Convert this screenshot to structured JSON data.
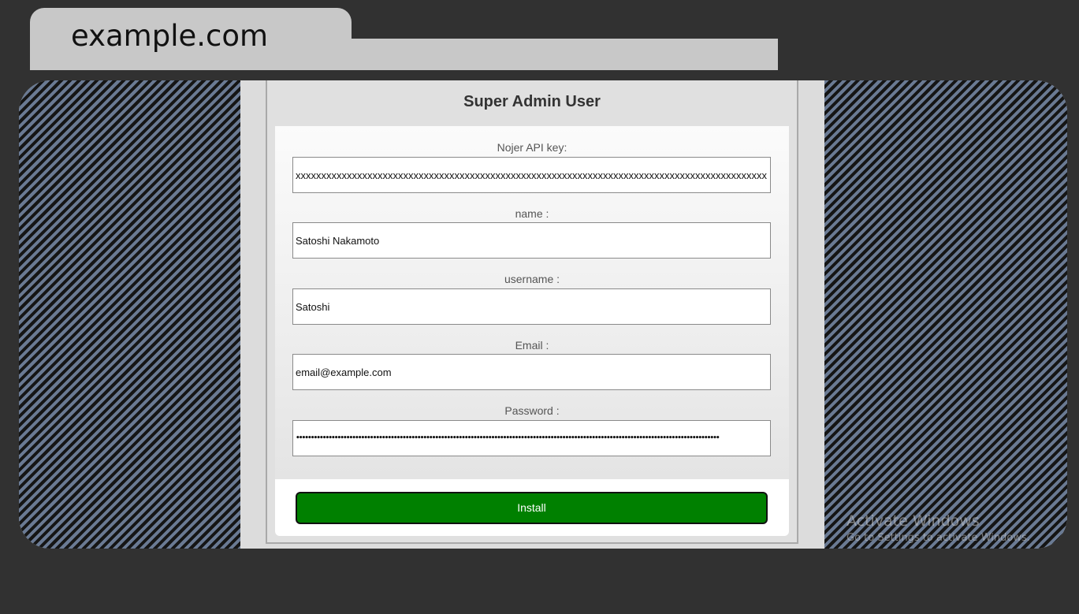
{
  "browser": {
    "tab_title": "example.com"
  },
  "form": {
    "title": "Super Admin User",
    "fields": [
      {
        "label": "Nojer API key:",
        "value": "xxxxxxxxxxxxxxxxxxxxxxxxxxxxxxxxxxxxxxxxxxxxxxxxxxxxxxxxxxxxxxxxxxxxxxxxxxxxxxxxxxxxxxxxxxxx"
      },
      {
        "label": "name :",
        "value": "Satoshi Nakamoto"
      },
      {
        "label": "username :",
        "value": "Satoshi"
      },
      {
        "label": "Email :",
        "value": "email@example.com"
      },
      {
        "label": "Password :",
        "value": "•••••••••••••••••••••••••••••••••••••••••••••••••••••••••••••••••••••••••••••••••••••••••••••••••••••••••••••••••••••••••••••••••••••••••••••••"
      }
    ],
    "submit_label": "Install"
  },
  "watermark": {
    "title": "Activate Windows",
    "subtitle": "Go to Settings to activate Windows."
  },
  "colors": {
    "page_background": "#313131",
    "tab_background": "#c8c8c8",
    "stripe_light": "#6a7a93",
    "stripe_dark": "#151515",
    "install_button": "#008000"
  }
}
